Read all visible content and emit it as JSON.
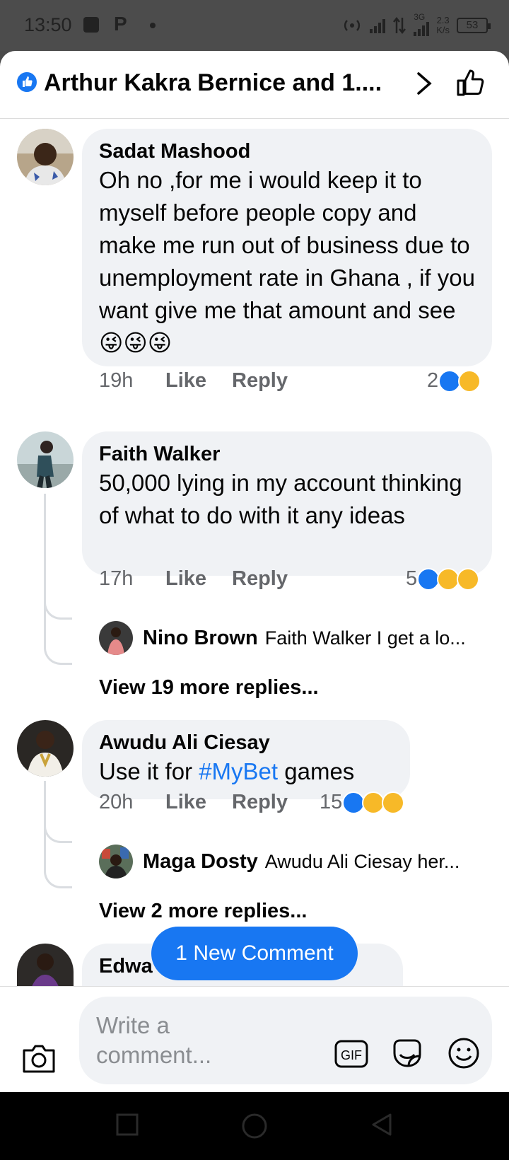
{
  "status_bar": {
    "time": "13:50",
    "p_icon": "P",
    "net_label": "3G",
    "net_speed": "2.3",
    "net_unit": "K/s",
    "battery": "53"
  },
  "header": {
    "title": "Arthur Kakra Bernice and 1...."
  },
  "comments": [
    {
      "name": "Sadat Mashood",
      "text": "Oh no ,for me i would keep it to myself before people  copy and make me run out of business due to unemployment rate in Ghana , if you want give me that amount and see 😜😜😜",
      "time": "19h",
      "like": "Like",
      "reply": "Reply",
      "reaction_count": "2"
    },
    {
      "name": "Faith Walker",
      "text": "50,000 lying in my account thinking of what to do with it any ideas",
      "time": "17h",
      "like": "Like",
      "reply": "Reply",
      "reaction_count": "5",
      "reply_preview": {
        "name": "Nino Brown",
        "text": "Faith Walker I get a lo..."
      },
      "view_more": "View 19 more replies..."
    },
    {
      "name": "Awudu Ali Ciesay",
      "text_before": "Use it for ",
      "hashtag": "#MyBet",
      "text_after": " games",
      "time": "20h",
      "like": "Like",
      "reply": "Reply",
      "reaction_count": "15",
      "reply_preview": {
        "name": "Maga Dosty",
        "text": "Awudu Ali Ciesay her..."
      },
      "view_more": "View 2 more replies..."
    },
    {
      "name": "Edwa"
    }
  ],
  "new_comment_pill": "1 New Comment",
  "composer": {
    "placeholder": "Write a comment...",
    "gif_label": "GIF"
  },
  "colors": {
    "accent": "#1877f2",
    "bubble": "#f0f2f5",
    "muted": "#65676b"
  }
}
